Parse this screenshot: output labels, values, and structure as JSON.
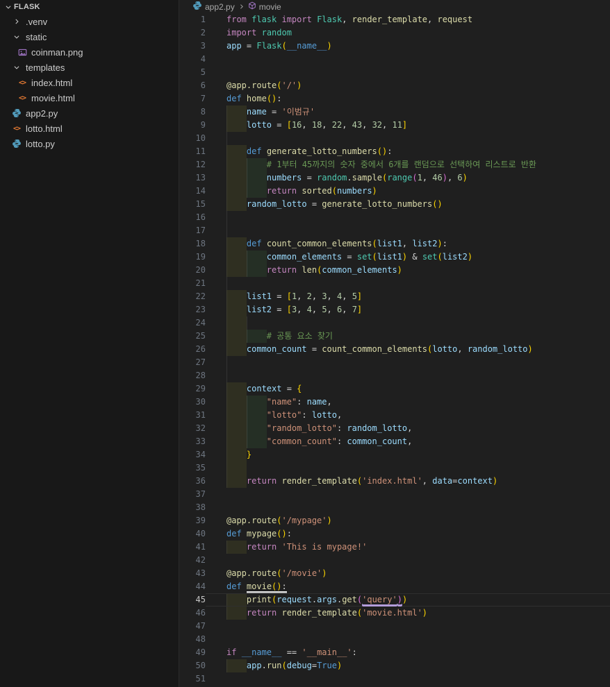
{
  "sidebar": {
    "title": "FLASK",
    "items": [
      {
        "label": ".venv",
        "icon": "chevron-right-icon",
        "kind": "folder-collapsed",
        "level": 1
      },
      {
        "label": "static",
        "icon": "chevron-down-icon",
        "kind": "folder-expanded",
        "level": 1
      },
      {
        "label": "coinman.png",
        "icon": "image-icon",
        "kind": "file",
        "level": 2
      },
      {
        "label": "templates",
        "icon": "chevron-down-icon",
        "kind": "folder-expanded",
        "level": 1
      },
      {
        "label": "index.html",
        "icon": "html-icon",
        "kind": "file",
        "level": 2
      },
      {
        "label": "movie.html",
        "icon": "html-icon",
        "kind": "file",
        "level": 2
      },
      {
        "label": "app2.py",
        "icon": "python-icon",
        "kind": "file",
        "level": 1
      },
      {
        "label": "lotto.html",
        "icon": "html-icon",
        "kind": "file",
        "level": 1
      },
      {
        "label": "lotto.py",
        "icon": "python-icon",
        "kind": "file",
        "level": 1
      }
    ]
  },
  "breadcrumb": {
    "items": [
      {
        "label": "app2.py",
        "icon": "python-icon"
      },
      {
        "label": "movie",
        "icon": "symbol-cube-icon"
      }
    ]
  },
  "editor": {
    "language": "python",
    "current_line": 45,
    "colors": {
      "editor_background": "#1f1f1f",
      "sidebar_background": "#181818",
      "python_icon": "#519aba",
      "html_icon": "#e37933",
      "image_icon": "#a074c4",
      "cube_icon": "#b180d7",
      "token_keyword": "#C586C0",
      "token_keyword2": "#569CD6",
      "token_function": "#DCDCAA",
      "token_class": "#4EC9B0",
      "token_variable": "#9CDCFE",
      "token_number": "#B5CEA8",
      "token_string": "#CE9178",
      "token_comment": "#6A9955",
      "token_default": "#D4D4D4",
      "bracket_level1": "#FFD700",
      "bracket_level2": "#DA70D6",
      "underline_white": "#e0e0e0",
      "underline_purple": "#b39ddb"
    },
    "lines": [
      {
        "n": 1,
        "ind": 0,
        "segs": [
          [
            "from ",
            "k"
          ],
          [
            "flask",
            "t"
          ],
          [
            " ",
            "w"
          ],
          [
            "import",
            "k"
          ],
          [
            " ",
            "w"
          ],
          [
            "Flask",
            "t"
          ],
          [
            ", ",
            "w"
          ],
          [
            "render_template",
            "f"
          ],
          [
            ", ",
            "w"
          ],
          [
            "request",
            "f"
          ]
        ]
      },
      {
        "n": 2,
        "ind": 0,
        "segs": [
          [
            "import",
            "k"
          ],
          [
            " ",
            "w"
          ],
          [
            "random",
            "t"
          ]
        ]
      },
      {
        "n": 3,
        "ind": 0,
        "segs": [
          [
            "app",
            "v"
          ],
          [
            " = ",
            "w"
          ],
          [
            "Flask",
            "t"
          ],
          [
            "(",
            "b1"
          ],
          [
            "__name__",
            "d"
          ],
          [
            ")",
            "b1"
          ]
        ]
      },
      {
        "n": 4,
        "ind": 0,
        "segs": []
      },
      {
        "n": 5,
        "ind": 0,
        "segs": []
      },
      {
        "n": 6,
        "ind": 0,
        "segs": [
          [
            "@app.route",
            "f"
          ],
          [
            "(",
            "b1"
          ],
          [
            "'/'",
            "s"
          ],
          [
            ")",
            "b1"
          ]
        ]
      },
      {
        "n": 7,
        "ind": 0,
        "segs": [
          [
            "def",
            "d"
          ],
          [
            " ",
            "w"
          ],
          [
            "home",
            "f"
          ],
          [
            "()",
            "b1"
          ],
          [
            ":",
            "w"
          ]
        ]
      },
      {
        "n": 8,
        "ind": 4,
        "segs": [
          [
            "name",
            "v"
          ],
          [
            " = ",
            "w"
          ],
          [
            "'이범규'",
            "s"
          ]
        ]
      },
      {
        "n": 9,
        "ind": 4,
        "segs": [
          [
            "lotto",
            "v"
          ],
          [
            " = ",
            "w"
          ],
          [
            "[",
            "b1"
          ],
          [
            "16",
            "n"
          ],
          [
            ", ",
            "w"
          ],
          [
            "18",
            "n"
          ],
          [
            ", ",
            "w"
          ],
          [
            "22",
            "n"
          ],
          [
            ", ",
            "w"
          ],
          [
            "43",
            "n"
          ],
          [
            ", ",
            "w"
          ],
          [
            "32",
            "n"
          ],
          [
            ", ",
            "w"
          ],
          [
            "11",
            "n"
          ],
          [
            "]",
            "b1"
          ]
        ]
      },
      {
        "n": 10,
        "ind": 0,
        "segs": [],
        "g1": true
      },
      {
        "n": 11,
        "ind": 4,
        "segs": [
          [
            "def",
            "d"
          ],
          [
            " ",
            "w"
          ],
          [
            "generate_lotto_numbers",
            "f"
          ],
          [
            "()",
            "b1"
          ],
          [
            ":",
            "w"
          ]
        ]
      },
      {
        "n": 12,
        "ind": 8,
        "segs": [
          [
            "# 1부터 45까지의 숫자 중에서 6개를 랜덤으로 선택하여 리스트로 반환",
            "c"
          ]
        ]
      },
      {
        "n": 13,
        "ind": 8,
        "segs": [
          [
            "numbers",
            "v"
          ],
          [
            " = ",
            "w"
          ],
          [
            "random",
            "t"
          ],
          [
            ".",
            "w"
          ],
          [
            "sample",
            "f"
          ],
          [
            "(",
            "b1"
          ],
          [
            "range",
            "t"
          ],
          [
            "(",
            "b2"
          ],
          [
            "1",
            "n"
          ],
          [
            ", ",
            "w"
          ],
          [
            "46",
            "n"
          ],
          [
            ")",
            "b2"
          ],
          [
            ", ",
            "w"
          ],
          [
            "6",
            "n"
          ],
          [
            ")",
            "b1"
          ]
        ]
      },
      {
        "n": 14,
        "ind": 8,
        "segs": [
          [
            "return",
            "k"
          ],
          [
            " ",
            "w"
          ],
          [
            "sorted",
            "f"
          ],
          [
            "(",
            "b1"
          ],
          [
            "numbers",
            "v"
          ],
          [
            ")",
            "b1"
          ]
        ]
      },
      {
        "n": 15,
        "ind": 4,
        "segs": [
          [
            "random_lotto",
            "v"
          ],
          [
            " = ",
            "w"
          ],
          [
            "generate_lotto_numbers",
            "f"
          ],
          [
            "()",
            "b1"
          ]
        ]
      },
      {
        "n": 16,
        "ind": 0,
        "segs": [],
        "g1": true
      },
      {
        "n": 17,
        "ind": 0,
        "segs": [],
        "g1": true
      },
      {
        "n": 18,
        "ind": 4,
        "segs": [
          [
            "def",
            "d"
          ],
          [
            " ",
            "w"
          ],
          [
            "count_common_elements",
            "f"
          ],
          [
            "(",
            "b1"
          ],
          [
            "list1",
            "v"
          ],
          [
            ", ",
            "w"
          ],
          [
            "list2",
            "v"
          ],
          [
            ")",
            "b1"
          ],
          [
            ":",
            "w"
          ]
        ]
      },
      {
        "n": 19,
        "ind": 8,
        "segs": [
          [
            "common_elements",
            "v"
          ],
          [
            " = ",
            "w"
          ],
          [
            "set",
            "t"
          ],
          [
            "(",
            "b1"
          ],
          [
            "list1",
            "v"
          ],
          [
            ")",
            "b1"
          ],
          [
            " & ",
            "w"
          ],
          [
            "set",
            "t"
          ],
          [
            "(",
            "b1"
          ],
          [
            "list2",
            "v"
          ],
          [
            ")",
            "b1"
          ]
        ]
      },
      {
        "n": 20,
        "ind": 8,
        "segs": [
          [
            "return",
            "k"
          ],
          [
            " ",
            "w"
          ],
          [
            "len",
            "f"
          ],
          [
            "(",
            "b1"
          ],
          [
            "common_elements",
            "v"
          ],
          [
            ")",
            "b1"
          ]
        ]
      },
      {
        "n": 21,
        "ind": 0,
        "segs": [],
        "g1": true
      },
      {
        "n": 22,
        "ind": 4,
        "segs": [
          [
            "list1",
            "v"
          ],
          [
            " = ",
            "w"
          ],
          [
            "[",
            "b1"
          ],
          [
            "1",
            "n"
          ],
          [
            ", ",
            "w"
          ],
          [
            "2",
            "n"
          ],
          [
            ", ",
            "w"
          ],
          [
            "3",
            "n"
          ],
          [
            ", ",
            "w"
          ],
          [
            "4",
            "n"
          ],
          [
            ", ",
            "w"
          ],
          [
            "5",
            "n"
          ],
          [
            "]",
            "b1"
          ]
        ]
      },
      {
        "n": 23,
        "ind": 4,
        "segs": [
          [
            "list2",
            "v"
          ],
          [
            " = ",
            "w"
          ],
          [
            "[",
            "b1"
          ],
          [
            "3",
            "n"
          ],
          [
            ", ",
            "w"
          ],
          [
            "4",
            "n"
          ],
          [
            ", ",
            "w"
          ],
          [
            "5",
            "n"
          ],
          [
            ", ",
            "w"
          ],
          [
            "6",
            "n"
          ],
          [
            ", ",
            "w"
          ],
          [
            "7",
            "n"
          ],
          [
            "]",
            "b1"
          ]
        ]
      },
      {
        "n": 24,
        "ind": 0,
        "segs": [],
        "ws4": true,
        "g2": true
      },
      {
        "n": 25,
        "ind": 8,
        "segs": [
          [
            "# 공통 요소 찾기",
            "c"
          ]
        ]
      },
      {
        "n": 26,
        "ind": 4,
        "segs": [
          [
            "common_count",
            "v"
          ],
          [
            " = ",
            "w"
          ],
          [
            "count_common_elements",
            "f"
          ],
          [
            "(",
            "b1"
          ],
          [
            "lotto",
            "v"
          ],
          [
            ", ",
            "w"
          ],
          [
            "random_lotto",
            "v"
          ],
          [
            ")",
            "b1"
          ]
        ]
      },
      {
        "n": 27,
        "ind": 0,
        "segs": [],
        "g1": true
      },
      {
        "n": 28,
        "ind": 0,
        "segs": [],
        "g1": true
      },
      {
        "n": 29,
        "ind": 4,
        "segs": [
          [
            "context",
            "v"
          ],
          [
            " = ",
            "w"
          ],
          [
            "{",
            "b1"
          ]
        ]
      },
      {
        "n": 30,
        "ind": 8,
        "segs": [
          [
            "\"name\"",
            "s"
          ],
          [
            ": ",
            "w"
          ],
          [
            "name",
            "v"
          ],
          [
            ",",
            "w"
          ]
        ]
      },
      {
        "n": 31,
        "ind": 8,
        "segs": [
          [
            "\"lotto\"",
            "s"
          ],
          [
            ": ",
            "w"
          ],
          [
            "lotto",
            "v"
          ],
          [
            ",",
            "w"
          ]
        ]
      },
      {
        "n": 32,
        "ind": 8,
        "segs": [
          [
            "\"random_lotto\"",
            "s"
          ],
          [
            ": ",
            "w"
          ],
          [
            "random_lotto",
            "v"
          ],
          [
            ",",
            "w"
          ]
        ]
      },
      {
        "n": 33,
        "ind": 8,
        "segs": [
          [
            "\"common_count\"",
            "s"
          ],
          [
            ": ",
            "w"
          ],
          [
            "common_count",
            "v"
          ],
          [
            ",",
            "w"
          ]
        ]
      },
      {
        "n": 34,
        "ind": 4,
        "segs": [
          [
            "}",
            "b1"
          ]
        ]
      },
      {
        "n": 35,
        "ind": 0,
        "segs": [],
        "ws4": true
      },
      {
        "n": 36,
        "ind": 4,
        "segs": [
          [
            "return",
            "k"
          ],
          [
            " ",
            "w"
          ],
          [
            "render_template",
            "f"
          ],
          [
            "(",
            "b1"
          ],
          [
            "'index.html'",
            "s"
          ],
          [
            ", ",
            "w"
          ],
          [
            "data",
            "v"
          ],
          [
            "=",
            "w"
          ],
          [
            "context",
            "v"
          ],
          [
            ")",
            "b1"
          ]
        ]
      },
      {
        "n": 37,
        "ind": 0,
        "segs": []
      },
      {
        "n": 38,
        "ind": 0,
        "segs": []
      },
      {
        "n": 39,
        "ind": 0,
        "segs": [
          [
            "@app.route",
            "f"
          ],
          [
            "(",
            "b1"
          ],
          [
            "'/mypage'",
            "s"
          ],
          [
            ")",
            "b1"
          ]
        ]
      },
      {
        "n": 40,
        "ind": 0,
        "segs": [
          [
            "def",
            "d"
          ],
          [
            " ",
            "w"
          ],
          [
            "mypage",
            "f"
          ],
          [
            "()",
            "b1"
          ],
          [
            ":",
            "w"
          ]
        ]
      },
      {
        "n": 41,
        "ind": 4,
        "segs": [
          [
            "return",
            "k"
          ],
          [
            " ",
            "w"
          ],
          [
            "'This is mypage!'",
            "s"
          ]
        ]
      },
      {
        "n": 42,
        "ind": 0,
        "segs": []
      },
      {
        "n": 43,
        "ind": 0,
        "segs": [
          [
            "@app.route",
            "f"
          ],
          [
            "(",
            "b1"
          ],
          [
            "'/movie'",
            "s"
          ],
          [
            ")",
            "b1"
          ]
        ]
      },
      {
        "n": 44,
        "ind": 0,
        "segs": [
          [
            "def",
            "d"
          ],
          [
            " ",
            "w"
          ],
          [
            "movie",
            "f",
            "uw"
          ],
          [
            "()",
            "b1",
            "uw"
          ],
          [
            ":",
            "w",
            "uw"
          ]
        ]
      },
      {
        "n": 45,
        "ind": 4,
        "cur": true,
        "segs": [
          [
            "print",
            "f"
          ],
          [
            "(",
            "b1"
          ],
          [
            "request",
            "v"
          ],
          [
            ".",
            "w"
          ],
          [
            "args",
            "v"
          ],
          [
            ".",
            "w"
          ],
          [
            "get",
            "f"
          ],
          [
            "(",
            "b2"
          ],
          [
            "'query'",
            "s",
            "up"
          ],
          [
            ")",
            "b2",
            "up"
          ],
          [
            ")",
            "b1"
          ]
        ]
      },
      {
        "n": 46,
        "ind": 4,
        "segs": [
          [
            "return",
            "k"
          ],
          [
            " ",
            "w"
          ],
          [
            "render_template",
            "f"
          ],
          [
            "(",
            "b1"
          ],
          [
            "'movie.html'",
            "s"
          ],
          [
            ")",
            "b1"
          ]
        ]
      },
      {
        "n": 47,
        "ind": 0,
        "segs": []
      },
      {
        "n": 48,
        "ind": 0,
        "segs": []
      },
      {
        "n": 49,
        "ind": 0,
        "segs": [
          [
            "if",
            "k"
          ],
          [
            " ",
            "w"
          ],
          [
            "__name__",
            "d"
          ],
          [
            " == ",
            "w"
          ],
          [
            "'__main__'",
            "s"
          ],
          [
            ":",
            "w"
          ]
        ]
      },
      {
        "n": 50,
        "ind": 4,
        "segs": [
          [
            "app",
            "v"
          ],
          [
            ".",
            "w"
          ],
          [
            "run",
            "f"
          ],
          [
            "(",
            "b1"
          ],
          [
            "debug",
            "v"
          ],
          [
            "=",
            "w"
          ],
          [
            "True",
            "d"
          ],
          [
            ")",
            "b1"
          ]
        ]
      },
      {
        "n": 51,
        "ind": 0,
        "segs": []
      }
    ]
  }
}
